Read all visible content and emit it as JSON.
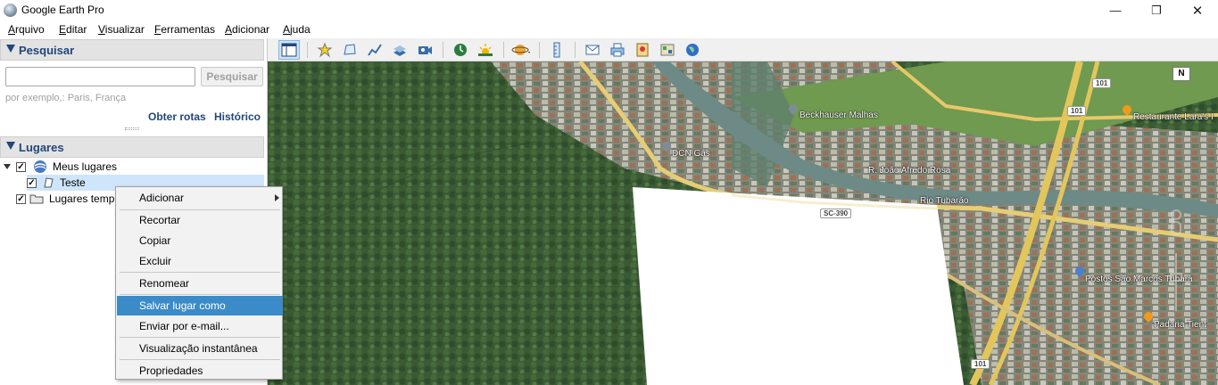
{
  "window": {
    "title": "Google Earth Pro",
    "minimize": "—",
    "maximize": "❐",
    "close": "✕"
  },
  "menu": [
    "Arquivo",
    "Editar",
    "Visualizar",
    "Ferramentas",
    "Adicionar",
    "Ajuda"
  ],
  "search": {
    "header": "Pesquisar",
    "input_value": "",
    "button": "Pesquisar",
    "hint": "por exemplo,: Paris, França",
    "directions": "Obter rotas",
    "history": "Histórico"
  },
  "places": {
    "header": "Lugares",
    "items": [
      {
        "label": "Meus lugares",
        "checked": true
      },
      {
        "label": "Teste",
        "checked": true,
        "selected": true
      },
      {
        "label": "Lugares temp",
        "checked": true
      }
    ]
  },
  "context_menu": {
    "items": [
      "Adicionar",
      "Recortar",
      "Copiar",
      "Excluir",
      "Renomear",
      "Salvar lugar como",
      "Enviar por e-mail...",
      "Visualização instantânea",
      "Propriedades"
    ],
    "highlighted": "Salvar lugar como"
  },
  "map": {
    "labels": [
      "Beckhauser Malhas",
      "DCN Gás",
      "R. João Afredo Rosa",
      "Rio Tubarão",
      "Postos São Marcos Tubará",
      "Padaria Tient",
      "Restaurante Lara's I"
    ],
    "road_signs": [
      "SC-390",
      "101",
      "101",
      "101"
    ],
    "compass": "N"
  },
  "colors": {
    "accent": "#23467a",
    "highlight": "#3c8bc9",
    "selection": "#cfe5fb"
  }
}
